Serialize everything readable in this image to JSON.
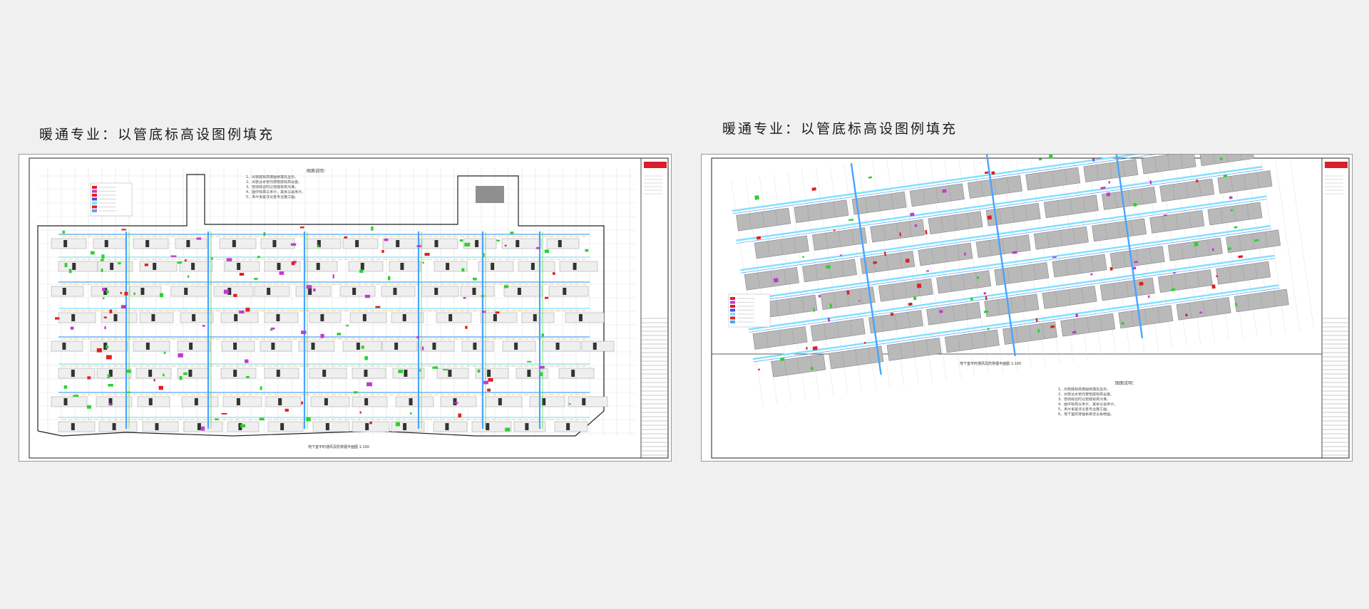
{
  "captions": {
    "left": "暖通专业：以管底标高设图例填充",
    "right": "暖通专业：以管底标高设图例填充"
  },
  "drawings": {
    "left": {
      "notes_title": "图面说明：",
      "notes": [
        "1、风管底标高按图例填充显示。",
        "2、风管及水管均按管底标高设置。",
        "3、管线综合时以管底标高为准。",
        "4、图中标高以米计，其余以毫米计。",
        "5、未尽事宜详见各专业施工图。"
      ],
      "title_line": "地下室平时通风及防排烟平面图 1:100"
    },
    "right": {
      "notes_title": "图面说明：",
      "notes": [
        "1、风管底标高按图例填充显示。",
        "2、风管及水管均按管底标高设置。",
        "3、管线综合时以管底标高为准。",
        "4、图中标高以米计，其余以毫米计。",
        "5、未尽事宜详见各专业施工图。",
        "6、地下室防排烟系统详见系统图。"
      ],
      "title_line": "地下室平时通风及防排烟平面图 1:100"
    }
  },
  "colors": {
    "background": "#f0f0f0",
    "parking_fill": "#b9b9b9",
    "duct_blue": "#4aa3ff",
    "duct_cyan": "#7fe0ff",
    "pipe_green": "#2fd02f",
    "pipe_red": "#e02020",
    "pipe_magenta": "#c03ad0",
    "stamp_red": "#d8202a"
  }
}
